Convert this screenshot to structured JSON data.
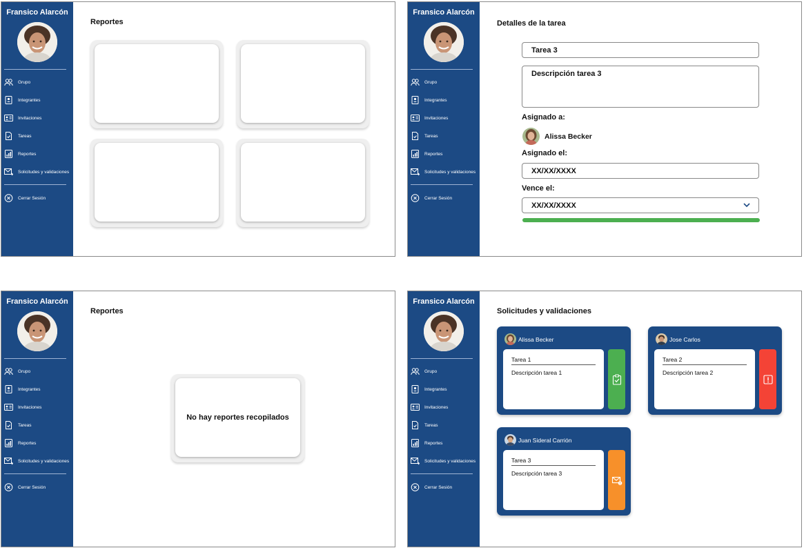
{
  "user": {
    "name": "Fransico Alarcón"
  },
  "nav": {
    "items": [
      {
        "label": "Grupo",
        "icon": "group-icon"
      },
      {
        "label": "Integrantes",
        "icon": "member-card-icon"
      },
      {
        "label": "Invitaciones",
        "icon": "invitation-card-icon"
      },
      {
        "label": "Tareas",
        "icon": "task-doc-icon"
      },
      {
        "label": "Reportes",
        "icon": "report-chart-icon"
      },
      {
        "label": "Solicitudes y validaciones",
        "icon": "mail-request-icon"
      }
    ],
    "logout": {
      "label": "Cerrar Sesión",
      "icon": "close-circle-icon"
    }
  },
  "screens": {
    "reportes_grid": {
      "title": "Reportes"
    },
    "detalle_tarea": {
      "title": "Detalles de la tarea",
      "task_name": "Tarea 3",
      "task_description": "Descripción tarea 3",
      "assigned_to_label": "Asignado a:",
      "assignee_name": "Alissa Becker",
      "assigned_on_label": "Asignado el:",
      "assigned_on_value": "XX/XX/XXXX",
      "due_label": "Vence el:",
      "due_value": "XX/XX/XXXX",
      "progress": 1.0
    },
    "reportes_vacio": {
      "title": "Reportes",
      "empty_message": "No hay reportes recopilados"
    },
    "solicitudes": {
      "title": "Solicitudes y validaciones",
      "cards": [
        {
          "person": "Alissa Becker",
          "task": "Tarea 1",
          "description": "Descripción tarea 1",
          "status_color": "#4caf50",
          "status_icon": "clipboard-check-icon"
        },
        {
          "person": "Jose Carlos",
          "task": "Tarea 2",
          "description": "Descripción tarea 2",
          "status_color": "#f44336",
          "status_icon": "alert-icon"
        },
        {
          "person": "Juan Sideral Carrión",
          "task": "Tarea 3",
          "description": "Descripción tarea 3",
          "status_color": "#f7902a",
          "status_icon": "mail-alert-icon"
        }
      ]
    }
  },
  "colors": {
    "sidebar": "#1c4a84",
    "progress": "#4caf50",
    "dropdown_chevron": "#1c4a84"
  }
}
